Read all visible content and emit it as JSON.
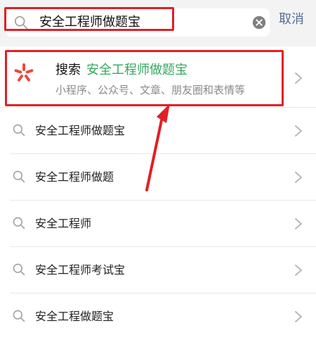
{
  "search": {
    "query": "安全工程师做题宝",
    "cancel_label": "取消"
  },
  "suggestion": {
    "prefix": "搜索",
    "query": "安全工程师做题宝",
    "subtitle": "小程序、公众号、文章、朋友圈和表情等"
  },
  "history": [
    {
      "label": "安全工程师做题宝"
    },
    {
      "label": "安全工程师做题"
    },
    {
      "label": "安全工程师"
    },
    {
      "label": "安全工程师考试宝"
    },
    {
      "label": "安全工程做题宝"
    }
  ],
  "colors": {
    "highlight": "#33a85f",
    "annotation": "#e21f25",
    "cancel": "#576b95"
  },
  "icons": {
    "search": "magnifier-icon",
    "clear": "clear-x-icon",
    "chevron": "chevron-right-icon",
    "logo": "wechat-search-star-icon",
    "arrow": "red-up-arrow-icon"
  }
}
